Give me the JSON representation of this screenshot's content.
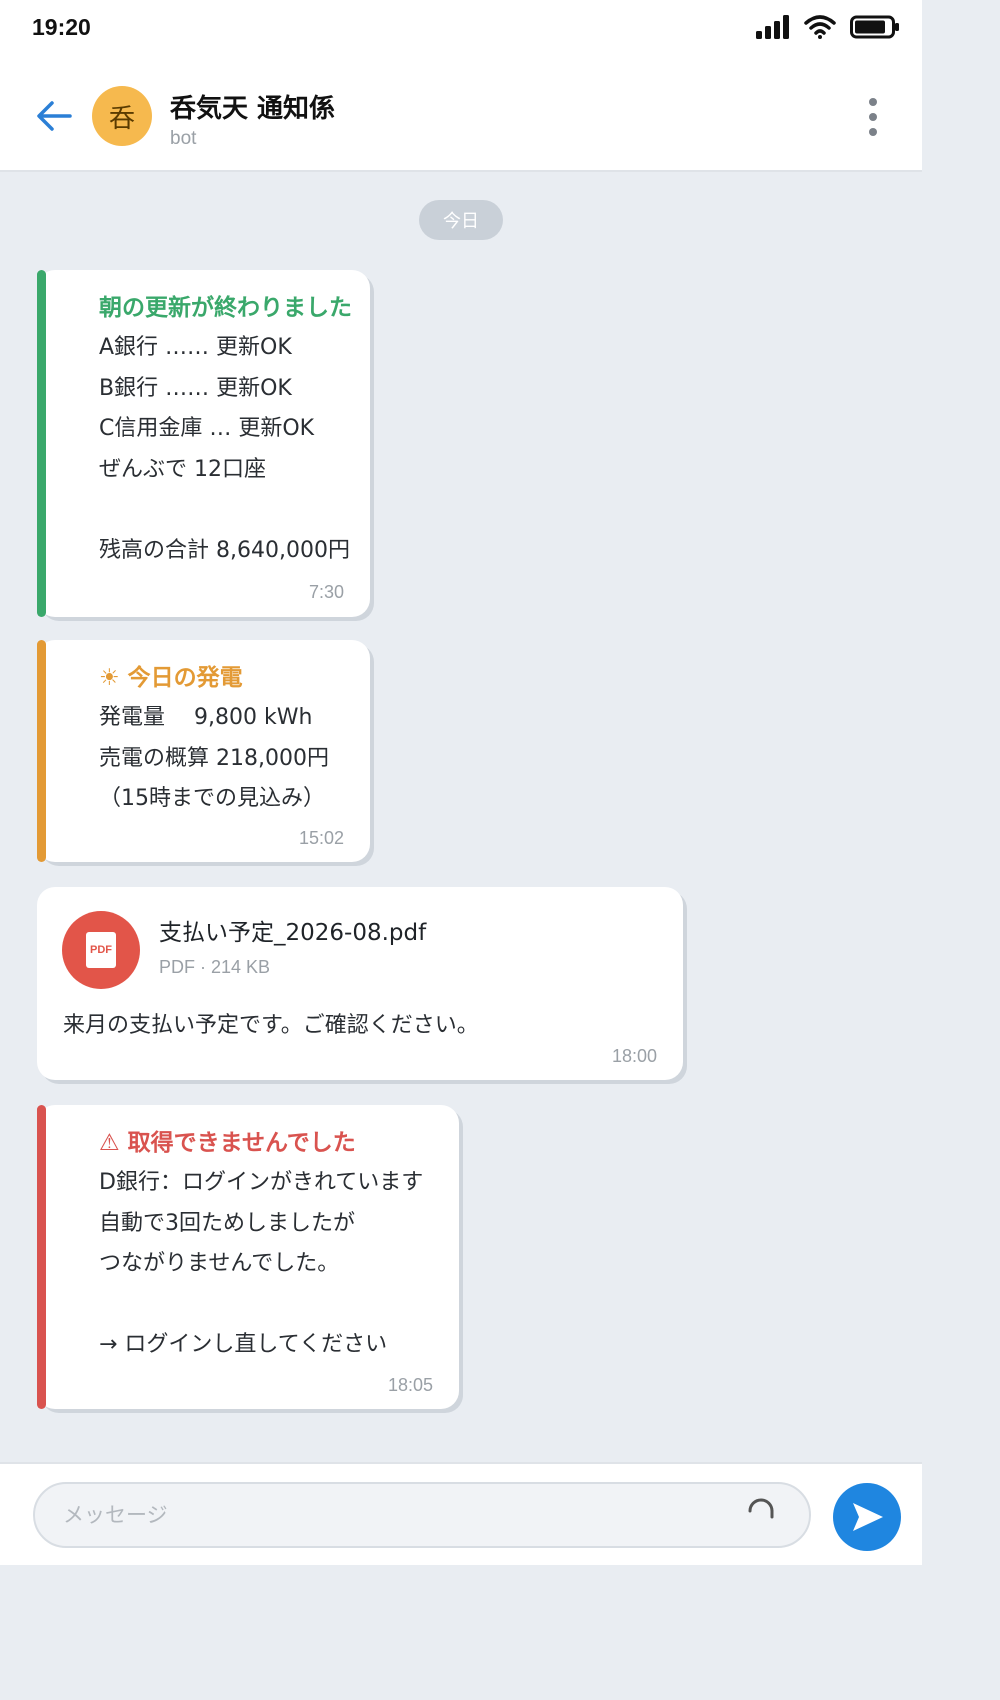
{
  "status": {
    "time": "19:20"
  },
  "header": {
    "avatar_char": "呑",
    "title": "呑気天 通知係",
    "subtitle": "bot"
  },
  "date_divider": "今日",
  "messages": {
    "m1": {
      "title": "朝の更新が終わりました",
      "lines": [
        "A銀行 …… 更新OK",
        "B銀行 …… 更新OK",
        "C信用金庫 … 更新OK",
        "ぜんぶで 12口座",
        "",
        "残高の合計 8,640,000円"
      ],
      "time": "7:30",
      "accent": "#3aa86b"
    },
    "m2": {
      "title_icon": "☀",
      "title": "今日の発電",
      "lines": [
        "発電量　 9,800 kWh",
        "売電の概算 218,000円",
        "（15時までの見込み）"
      ],
      "time": "15:02",
      "accent": "#e39a35"
    },
    "m3": {
      "file_icon_text": "PDF",
      "file_name": "支払い予定_2026-08.pdf",
      "file_meta": "PDF · 214 KB",
      "text": "来月の支払い予定です。ご確認ください。",
      "time": "18:00"
    },
    "m4": {
      "title_icon": "⚠",
      "title": "取得できませんでした",
      "lines": [
        "D銀行：ログインがきれています",
        "自動で3回ためしましたが",
        "つながりませんでした。",
        "",
        "→ ログインし直してください"
      ],
      "time": "18:05",
      "accent": "#d9534f"
    }
  },
  "composer": {
    "placeholder": "メッセージ"
  },
  "colors": {
    "send": "#1f86e0",
    "avatar": "#f6b94e",
    "pdf": "#e25549"
  }
}
